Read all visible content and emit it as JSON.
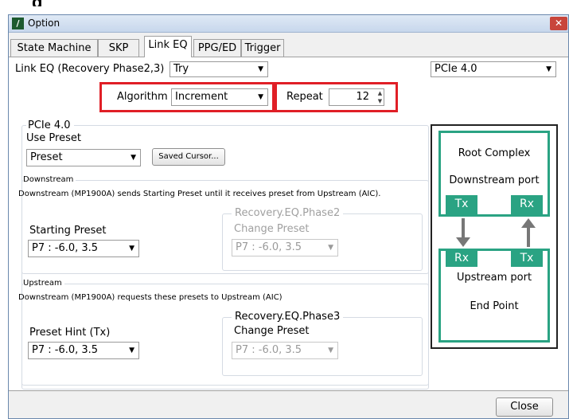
{
  "heading": "g",
  "window": {
    "title": "Option",
    "app_icon": "option-app-icon",
    "close": "✕"
  },
  "tabs": [
    "State Machine",
    "SKP",
    "Link EQ",
    "PPG/ED",
    "Trigger"
  ],
  "link_eq": {
    "label": "Link EQ (Recovery Phase2,3)",
    "value": "Try"
  },
  "standard": {
    "value": "PCIe 4.0"
  },
  "algorithm": {
    "label": "Algorithm",
    "value": "Increment"
  },
  "repeat": {
    "label": "Repeat",
    "value": "12"
  },
  "pcie_group": {
    "title": "PCIe 4.0",
    "use_preset_label": "Use Preset",
    "use_preset_value": "Preset",
    "saved_cursor": "Saved Cursor..."
  },
  "downstream": {
    "title": "Downstream",
    "desc": "Downstream (MP1900A) sends Starting Preset until it receives preset from Upstream (AIC).",
    "starting_label": "Starting Preset",
    "starting_value": "P7 : -6.0, 3.5",
    "phase_title": "Recovery.EQ.Phase2",
    "change_label": "Change Preset",
    "change_value": "P7 : -6.0, 3.5"
  },
  "upstream": {
    "title": "Upstream",
    "desc": "Downstream (MP1900A) requests these presets to Upstream (AIC)",
    "hint_label": "Preset Hint (Tx)",
    "hint_value": "P7 : -6.0, 3.5",
    "phase_title": "Recovery.EQ.Phase3",
    "change_label": "Change Preset",
    "change_value": "P7 : -6.0, 3.5"
  },
  "diagram": {
    "root_title": "Root Complex",
    "root_port": "Downstream port",
    "tx": "Tx",
    "rx": "Rx",
    "end_port": "Upstream port",
    "end_title": "End Point"
  },
  "close_button": "Close",
  "colors": {
    "accent": "#2aa383",
    "highlight": "#e01f26"
  }
}
